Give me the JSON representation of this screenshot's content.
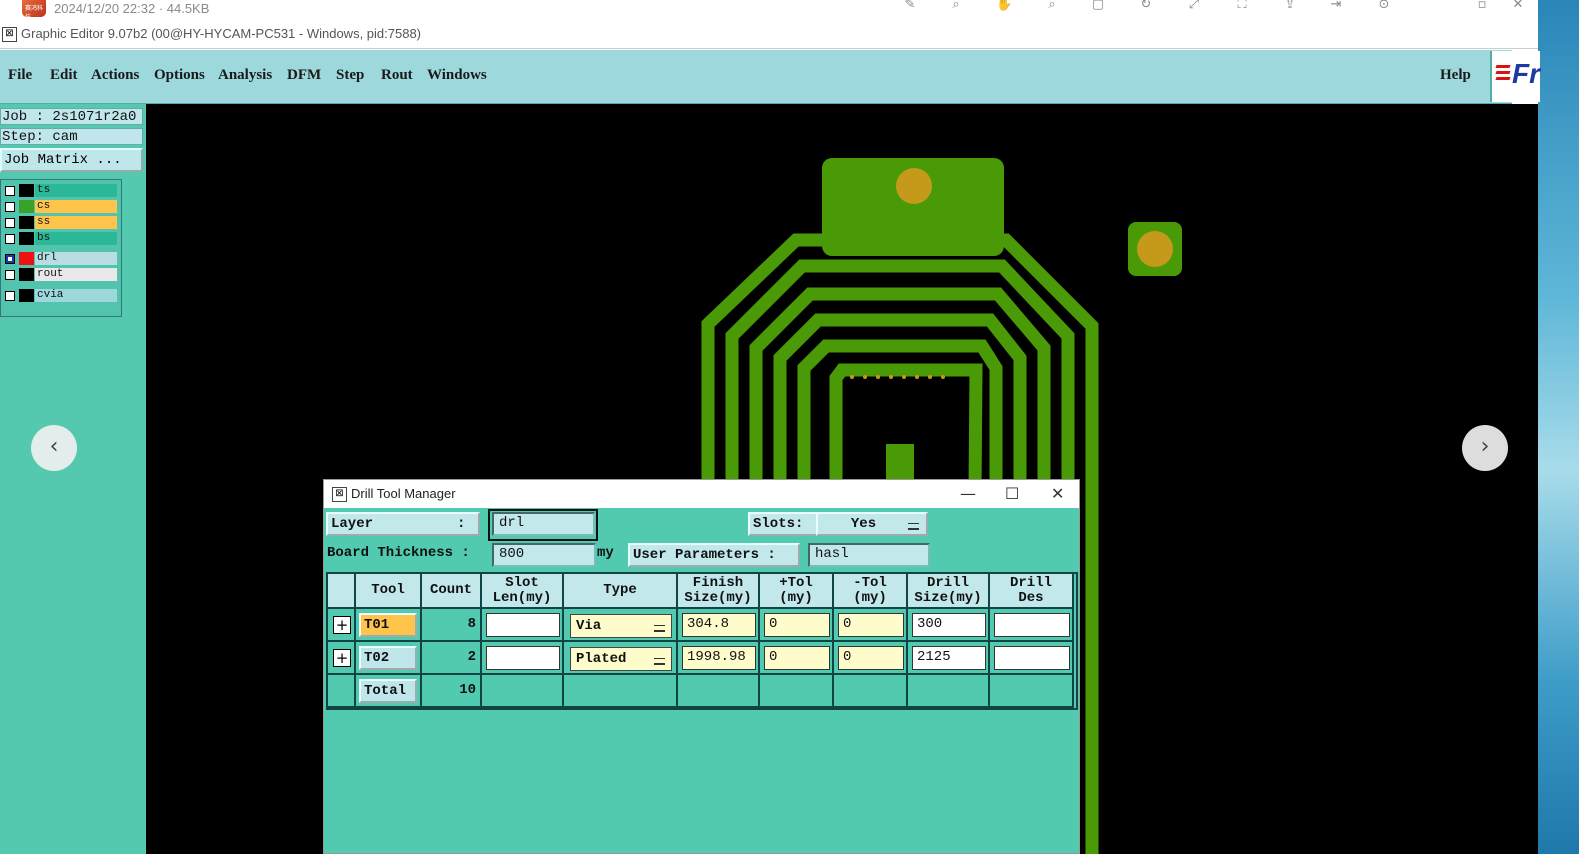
{
  "viewer": {
    "meta": "2024/12/20 22:32 · 44.5KB",
    "thumb_text": "赛鸿科技"
  },
  "window": {
    "title": "Graphic Editor 9.07b2 (00@HY-HYCAM-PC531 - Windows, pid:7588)"
  },
  "menu": {
    "items": [
      "File",
      "Edit",
      "Actions",
      "Options",
      "Analysis",
      "DFM",
      "Step",
      "Rout",
      "Windows"
    ],
    "help": "Help",
    "brand": "Fr"
  },
  "sidebar": {
    "job": "Job : 2s1071r2a0",
    "step": "Step: cam",
    "job_matrix": "Job Matrix ...",
    "layers": [
      {
        "name": "ts",
        "swatch": "#000000",
        "bg": "#2ab898"
      },
      {
        "name": "cs",
        "swatch": "#3aa22a",
        "bg": "#ffc44c"
      },
      {
        "name": "ss",
        "swatch": "#000000",
        "bg": "#ffc44c"
      },
      {
        "name": "bs",
        "swatch": "#000000",
        "bg": "#2ab898"
      },
      {
        "name": "drl",
        "swatch": "#ee1111",
        "bg": "#b8dde2"
      },
      {
        "name": "rout",
        "swatch": "#000000",
        "bg": "#e8e8e8"
      },
      {
        "name": "cvia",
        "swatch": "#000000",
        "bg": "#9cd8dc"
      }
    ]
  },
  "colors": {
    "copper": "#4a9a08",
    "pad": "#c59a1a",
    "panel": "#52cab0",
    "menubar": "#9cd8dc"
  },
  "dialog": {
    "title": "Drill Tool Manager",
    "layer_label": "Layer          :",
    "layer_value": "drl",
    "slots_label": "Slots:",
    "slots_value": "Yes",
    "thickness_label": "Board Thickness :",
    "thickness_value": "800",
    "thickness_unit": "my",
    "user_params_label": "User Parameters :",
    "user_params_value": "hasl",
    "columns": [
      "",
      "Tool",
      "Count",
      "Slot\nLen(my)",
      "Type",
      "Finish\nSize(my)",
      "+Tol\n(my)",
      "-Tol\n(my)",
      "Drill\nSize(my)",
      "Drill\nDes"
    ],
    "rows": [
      {
        "tool": "T01",
        "count": "8",
        "slot": "",
        "type": "Via",
        "finish": "304.8",
        "ptol": "0",
        "mtol": "0",
        "drill": "300",
        "des": ""
      },
      {
        "tool": "T02",
        "count": "2",
        "slot": "",
        "type": "Plated",
        "finish": "1998.98",
        "ptol": "0",
        "mtol": "0",
        "drill": "2125",
        "des": ""
      }
    ],
    "total_label": "Total",
    "total_count": "10"
  }
}
